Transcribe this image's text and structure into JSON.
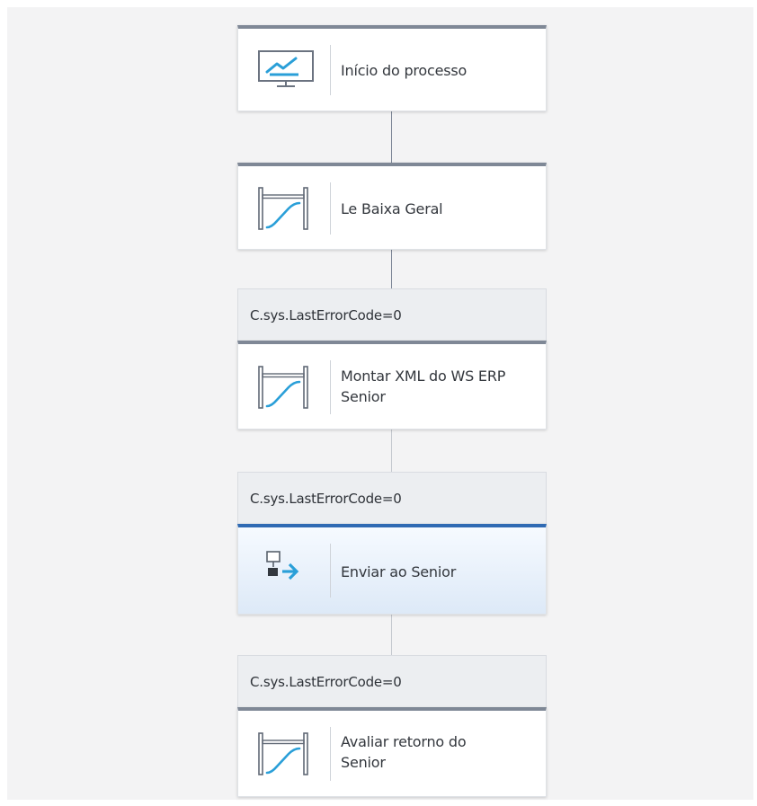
{
  "flow": {
    "steps": [
      {
        "label": "Início do processo",
        "condition": "",
        "icon": "monitor-chart-icon"
      },
      {
        "label": "Le Baixa Geral",
        "condition": "",
        "icon": "script-gate-icon"
      },
      {
        "label": "Montar XML do WS ERP Senior",
        "condition": "C.sys.LastErrorCode=0",
        "icon": "script-gate-icon"
      },
      {
        "label": "Enviar ao Senior",
        "condition": "C.sys.LastErrorCode=0",
        "icon": "send-arrow-icon",
        "selected": true
      },
      {
        "label": "Avaliar retorno do Senior",
        "condition": "C.sys.LastErrorCode=0",
        "icon": "script-gate-icon"
      }
    ]
  },
  "colors": {
    "canvas": "#f3f3f4",
    "node_border": "#7f8896",
    "selected_border": "#2f6ab3",
    "icon_blue": "#2a9fd8",
    "icon_outline": "#616976"
  }
}
